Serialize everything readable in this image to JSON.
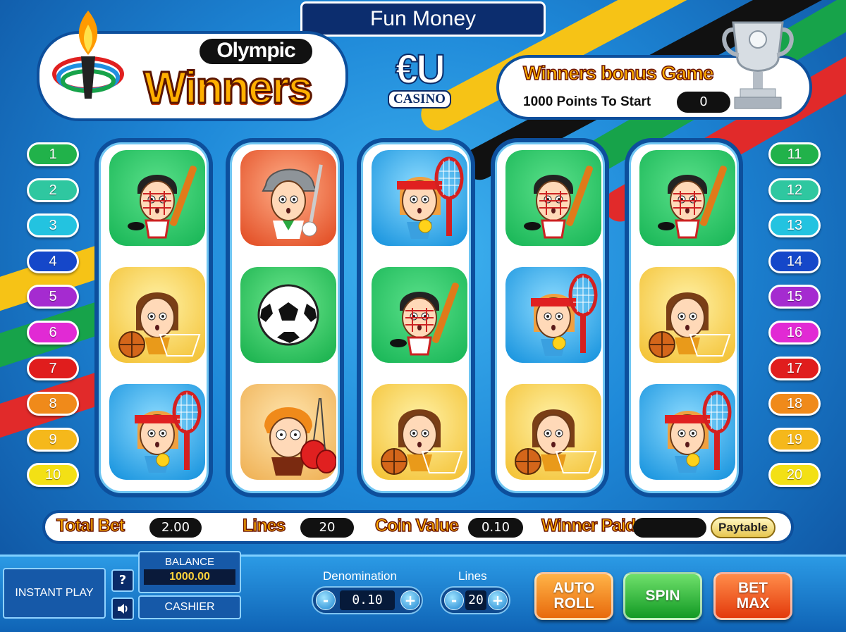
{
  "header": {
    "fun_money": "Fun Money",
    "logo_top": "Olympic",
    "logo_bottom": "Winners",
    "casino_mark": "€U",
    "casino_label": "CASINO"
  },
  "bonus": {
    "title": "Winners bonus Game",
    "subtitle": "1000 Points To Start",
    "points": "0"
  },
  "lines_left": [
    {
      "label": "1",
      "color": "#21b24a"
    },
    {
      "label": "2",
      "color": "#2fc7a0"
    },
    {
      "label": "3",
      "color": "#23c3e0"
    },
    {
      "label": "4",
      "color": "#1547c9"
    },
    {
      "label": "5",
      "color": "#a52bd0"
    },
    {
      "label": "6",
      "color": "#e12ad4"
    },
    {
      "label": "7",
      "color": "#e01d1d"
    },
    {
      "label": "8",
      "color": "#f08a1a"
    },
    {
      "label": "9",
      "color": "#f5b81b"
    },
    {
      "label": "10",
      "color": "#f3e015"
    }
  ],
  "lines_right": [
    {
      "label": "11",
      "color": "#21b24a"
    },
    {
      "label": "12",
      "color": "#2fc7a0"
    },
    {
      "label": "13",
      "color": "#23c3e0"
    },
    {
      "label": "14",
      "color": "#1547c9"
    },
    {
      "label": "15",
      "color": "#a52bd0"
    },
    {
      "label": "16",
      "color": "#e12ad4"
    },
    {
      "label": "17",
      "color": "#e01d1d"
    },
    {
      "label": "18",
      "color": "#f08a1a"
    },
    {
      "label": "19",
      "color": "#f5b81b"
    },
    {
      "label": "20",
      "color": "#f3e015"
    }
  ],
  "reels": [
    [
      "hockey",
      "basketball",
      "tennis"
    ],
    [
      "golf",
      "soccer",
      "boxing"
    ],
    [
      "tennis",
      "hockey",
      "basketball"
    ],
    [
      "hockey",
      "tennis",
      "basketball"
    ],
    [
      "hockey",
      "basketball",
      "tennis"
    ]
  ],
  "info": {
    "total_bet_label": "Total Bet",
    "total_bet_value": "2.00",
    "lines_label": "Lines",
    "lines_value": "20",
    "coin_value_label": "Coin Value",
    "coin_value_value": "0.10",
    "winner_paid_label": "Winner Paid",
    "winner_paid_value": "",
    "paytable_label": "Paytable"
  },
  "controls": {
    "instant_play": "INSTANT PLAY",
    "help_icon": "?",
    "sound_icon": "speaker-icon",
    "balance_label": "BALANCE",
    "balance_value": "1000.00",
    "cashier": "CASHIER",
    "denomination_label": "Denomination",
    "denomination_value": "0.10",
    "lines_label": "Lines",
    "lines_value": "20",
    "auto_roll": "AUTO\nROLL",
    "spin": "SPIN",
    "bet_max": "BET\nMAX",
    "minus": "-",
    "plus": "+"
  }
}
